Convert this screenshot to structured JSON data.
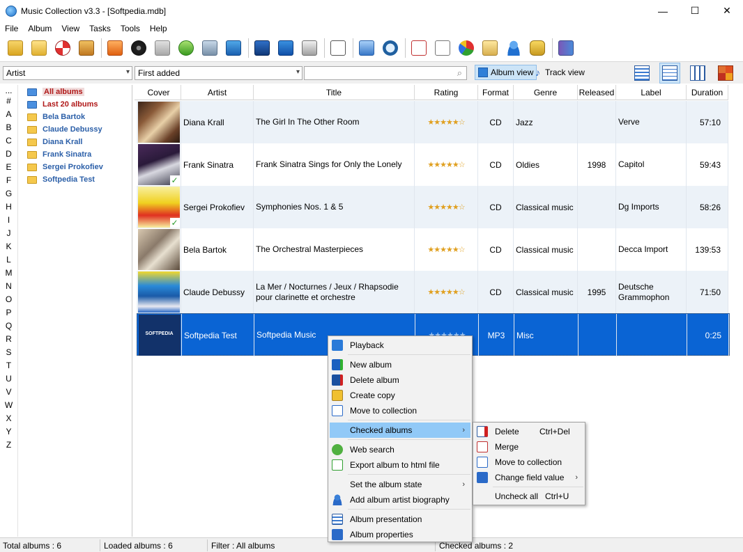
{
  "window": {
    "title": "Music Collection v3.3 - [Softpedia.mdb]",
    "minimize": "—",
    "maximize": "☐",
    "close": "✕"
  },
  "menu": [
    "File",
    "Album",
    "View",
    "Tasks",
    "Tools",
    "Help"
  ],
  "filter": {
    "field_combo": "Artist",
    "order_combo": "First added",
    "search_value": "",
    "album_view_label": "Album view",
    "track_view_label": "Track view"
  },
  "alphabet": [
    "...",
    "#",
    "A",
    "B",
    "C",
    "D",
    "E",
    "F",
    "G",
    "H",
    "I",
    "J",
    "K",
    "L",
    "M",
    "N",
    "O",
    "P",
    "Q",
    "R",
    "S",
    "T",
    "U",
    "V",
    "W",
    "X",
    "Y",
    "Z"
  ],
  "tree": [
    {
      "label": "All albums",
      "style": "red",
      "icon": "blue"
    },
    {
      "label": "Last 20 albums",
      "style": "red",
      "icon": "blue"
    },
    {
      "label": "Bela Bartok",
      "style": "blue",
      "icon": "yellow"
    },
    {
      "label": "Claude Debussy",
      "style": "blue",
      "icon": "yellow"
    },
    {
      "label": "Diana Krall",
      "style": "blue",
      "icon": "yellow"
    },
    {
      "label": "Frank Sinatra",
      "style": "blue",
      "icon": "yellow"
    },
    {
      "label": "Sergei Prokofiev",
      "style": "blue",
      "icon": "yellow"
    },
    {
      "label": "Softpedia Test",
      "style": "blue",
      "icon": "yellow"
    }
  ],
  "columns": [
    "Cover",
    "Artist",
    "Title",
    "Rating",
    "Format",
    "Genre",
    "Released",
    "Label",
    "Duration"
  ],
  "rows": [
    {
      "artist": "Diana Krall",
      "title": "The Girl In The Other Room",
      "rating": "★★★★★☆",
      "format": "CD",
      "genre": "Jazz",
      "released": "",
      "label": "Verve",
      "duration": "57:10"
    },
    {
      "artist": "Frank Sinatra",
      "title": "Frank Sinatra Sings for Only the Lonely",
      "rating": "★★★★★☆",
      "format": "CD",
      "genre": "Oldies",
      "released": "1998",
      "label": "Capitol",
      "duration": "59:43"
    },
    {
      "artist": "Sergei Prokofiev",
      "title": "Symphonies Nos. 1 & 5",
      "rating": "★★★★★☆",
      "format": "CD",
      "genre": "Classical music",
      "released": "",
      "label": "Dg Imports",
      "duration": "58:26"
    },
    {
      "artist": "Bela Bartok",
      "title": "The Orchestral Masterpieces",
      "rating": "★★★★★☆",
      "format": "CD",
      "genre": "Classical music",
      "released": "",
      "label": "Decca Import",
      "duration": "139:53"
    },
    {
      "artist": "Claude Debussy",
      "title": "La Mer / Nocturnes / Jeux / Rhapsodie pour clarinette et orchestre",
      "rating": "★★★★★☆",
      "format": "CD",
      "genre": "Classical music",
      "released": "1995",
      "label": "Deutsche Grammophon",
      "duration": "71:50"
    },
    {
      "artist": "Softpedia Test",
      "title": "Softpedia Music",
      "rating": "★★★★★★",
      "format": "MP3",
      "genre": "Misc",
      "released": "",
      "label": "",
      "duration": "0:25",
      "cover_text": "SOFTPEDIA"
    }
  ],
  "context_menu": {
    "playback": "Playback",
    "new_album": "New album",
    "delete_album": "Delete album",
    "create_copy": "Create copy",
    "move_to_collection": "Move to collection",
    "checked_albums": "Checked albums",
    "web_search": "Web search",
    "export_html": "Export album to html file",
    "set_state": "Set the album state",
    "add_biography": "Add album artist biography",
    "album_presentation": "Album presentation",
    "album_properties": "Album properties"
  },
  "submenu": {
    "delete": "Delete",
    "delete_shortcut": "Ctrl+Del",
    "merge": "Merge",
    "move_to_collection": "Move to collection",
    "change_field_value": "Change field value",
    "uncheck_all": "Uncheck all",
    "uncheck_shortcut": "Ctrl+U"
  },
  "status": {
    "total": "Total albums : 6",
    "loaded": "Loaded albums : 6",
    "filter": "Filter : All albums",
    "checked": "Checked albums : 2"
  },
  "colors": {
    "selection": "#0a64d4",
    "menu_highlight": "#91c9f7",
    "tree_blue": "#2b5fa8",
    "tree_red": "#b01818"
  }
}
